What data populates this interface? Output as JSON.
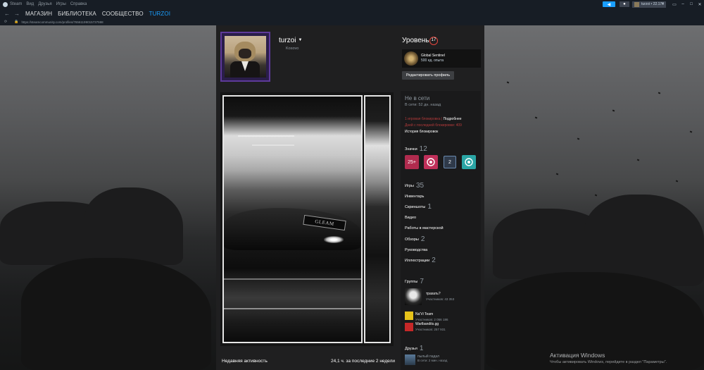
{
  "titlebar": {
    "app": "Steam",
    "menu": [
      "Вид",
      "Друзья",
      "Игры",
      "Справка"
    ],
    "user_label": "turzoi • 22.17₴"
  },
  "nav": {
    "tabs": [
      "МАГАЗИН",
      "БИБЛИОТЕКА",
      "СООБЩЕСТВО",
      "TURZOI"
    ],
    "active_index": 3,
    "url": "https://steamcommunity.com/profiles/76561199015737598"
  },
  "profile": {
    "username": "turzoi",
    "location": "Kosovo",
    "level_label": "Уровень",
    "level": "17",
    "badge_name": "Global Sentinel",
    "badge_xp": "500 ед. опыта",
    "edit_button": "Редактировать профиль"
  },
  "showcase": {
    "plate_text": "GLEAM"
  },
  "status": {
    "state": "Не в сети",
    "last_seen": "В сети: 52 дн. назад",
    "ban_text": "1 игровая блокировка",
    "ban_more": "Подробнее",
    "ban_days": "Дней с последней блокировки: 409",
    "ban_history": "История блокировок"
  },
  "sections": {
    "badges": {
      "label": "Значки",
      "count": "12"
    },
    "games": {
      "label": "Игры",
      "count": "35"
    },
    "inventory": {
      "label": "Инвентарь"
    },
    "screenshots": {
      "label": "Скриншоты",
      "count": "1"
    },
    "videos": {
      "label": "Видео"
    },
    "workshop": {
      "label": "Работы в мастерской"
    },
    "reviews": {
      "label": "Обзоры",
      "count": "2"
    },
    "guides": {
      "label": "Руководства"
    },
    "artwork": {
      "label": "Иллюстрации",
      "count": "2"
    },
    "groups": {
      "label": "Группы",
      "count": "7"
    },
    "friends": {
      "label": "Друзья",
      "count": "1"
    }
  },
  "badge_icons": [
    {
      "text": "25+",
      "color": "#b02b4e"
    },
    {
      "text": "",
      "color": "#c0305a"
    },
    {
      "text": "2",
      "color": "#3b5f8a"
    },
    {
      "text": "",
      "color": "#2aa5a5"
    }
  ],
  "groups": [
    {
      "name": "трахать?",
      "members": "Участников: 43 353"
    },
    {
      "name": "Na'Vi Team",
      "members": "Участников: 2 056 186"
    },
    {
      "name": "Warlbandits.gg",
      "members": "Участников: 257 931"
    }
  ],
  "friend": {
    "name": "пылый падал",
    "status": "В сети: 2 мин. назад"
  },
  "recent": {
    "label": "Недавняя активность",
    "hours": "24,1 ч. за последние 2 недели"
  },
  "windows": {
    "title": "Активация Windows",
    "sub": "Чтобы активировать Windows, перейдите в раздел \"Параметры\"."
  }
}
